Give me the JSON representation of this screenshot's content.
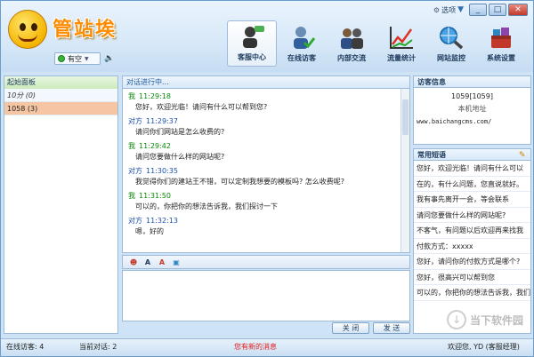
{
  "app": {
    "logo_text": "管站埃",
    "status_label": "有空",
    "options_label": "选项"
  },
  "nav": [
    {
      "label": "客服中心",
      "icon": "customer-service-icon"
    },
    {
      "label": "在线访客",
      "icon": "online-visitors-icon"
    },
    {
      "label": "内部交流",
      "icon": "internal-chat-icon"
    },
    {
      "label": "流量统计",
      "icon": "traffic-stats-icon"
    },
    {
      "label": "网站监控",
      "icon": "site-monitor-icon"
    },
    {
      "label": "系统设置",
      "icon": "system-settings-icon"
    }
  ],
  "left_panel": {
    "title": "起始面板",
    "rows": [
      "10分 (0)",
      "1058 (3)"
    ]
  },
  "conversation": {
    "title": "对话进行中...",
    "messages": [
      {
        "who": "我",
        "time": "11:29:18",
        "text": "您好，欢迎光临！请问有什么可以帮到您?"
      },
      {
        "who": "对方",
        "time": "11:29:37",
        "text": "请问你们网站是怎么收费的?"
      },
      {
        "who": "我",
        "time": "11:29:42",
        "text": "请问您要做什么样的网站呢?"
      },
      {
        "who": "对方",
        "time": "11:30:35",
        "text": "我觉得你们的建站王不错，可以定制我想要的模板吗? 怎么收费呢?"
      },
      {
        "who": "我",
        "time": "11:31:50",
        "text": "可以的，你把你的想法告诉我，我们探讨一下"
      },
      {
        "who": "对方",
        "time": "11:32:13",
        "text": "嗯，好的"
      }
    ]
  },
  "buttons": {
    "close": "关 闭",
    "send": "发 送"
  },
  "visitor": {
    "title": "访客信息",
    "id": "1059[1059]",
    "location": "本机地址",
    "url": "www.baichangcms.com/"
  },
  "quick_replies": {
    "title": "常用短语",
    "items": [
      "您好，欢迎光临！请问有什么可以",
      "在的，有什么问题，您直说就好。",
      "我有事先离开一会，等会联系",
      "请问您要做什么样的网站呢?",
      "不客气，有问题以后欢迎再来找我",
      "付款方式：xxxxx",
      "您好，请问你的付款方式是哪个?",
      "您好，很高兴可以帮到您",
      "可以的，你把你的想法告诉我，我们"
    ]
  },
  "watermark": "当下软件园",
  "statusbar": {
    "online": "在线访客: 4",
    "current": "当前对话: 2",
    "alert": "您有新的消息",
    "welcome": "欢迎您, YD (客服经理)"
  }
}
